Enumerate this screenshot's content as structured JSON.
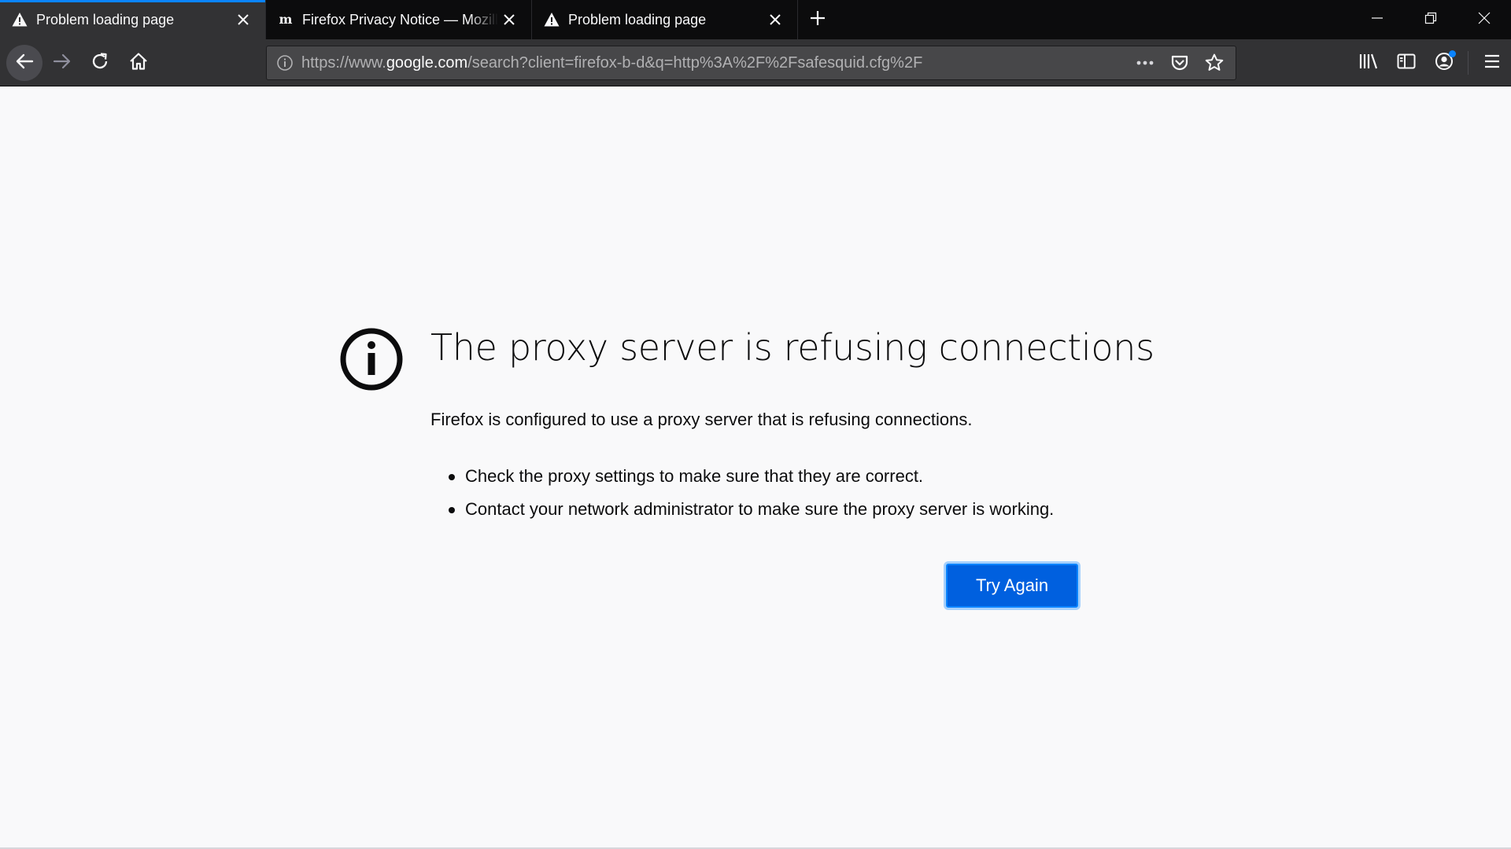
{
  "tabs": [
    {
      "title": "Problem loading page",
      "icon": "warning-icon",
      "selected": true
    },
    {
      "title": "Firefox Privacy Notice — Mozill",
      "icon": "mozilla-m-icon",
      "selected": false
    },
    {
      "title": "Problem loading page",
      "icon": "warning-icon",
      "selected": false
    }
  ],
  "new_tab_icon": "plus-icon",
  "window_controls": [
    "minimize-icon",
    "restore-icon",
    "close-icon"
  ],
  "nav": {
    "back_icon": "arrow-left-icon",
    "forward_icon": "arrow-right-icon",
    "reload_icon": "reload-icon",
    "home_icon": "home-icon"
  },
  "urlbar": {
    "prefix": "https://www.",
    "domain": "google.com",
    "path": "/search?client=firefox-b-d&q=http%3A%2F%2Fsafesquid.cfg%2F",
    "actions": [
      "more-icon",
      "pocket-icon",
      "bookmark-star-icon"
    ]
  },
  "toolbar_right": [
    "library-icon",
    "sidebar-icon",
    "account-icon",
    "menu-icon"
  ],
  "colors": {
    "accent": "#0a84ff",
    "button_blue": "#0060df",
    "tabbar_bg": "#0c0c0d",
    "toolbar_bg": "#323234",
    "page_bg": "#f9f9fa"
  },
  "error": {
    "title": "The proxy server is refusing connections",
    "description": "Firefox is configured to use a proxy server that is refusing connections.",
    "items": [
      "Check the proxy settings to make sure that they are correct.",
      "Contact your network administrator to make sure the proxy server is working."
    ],
    "button_label": "Try Again"
  }
}
